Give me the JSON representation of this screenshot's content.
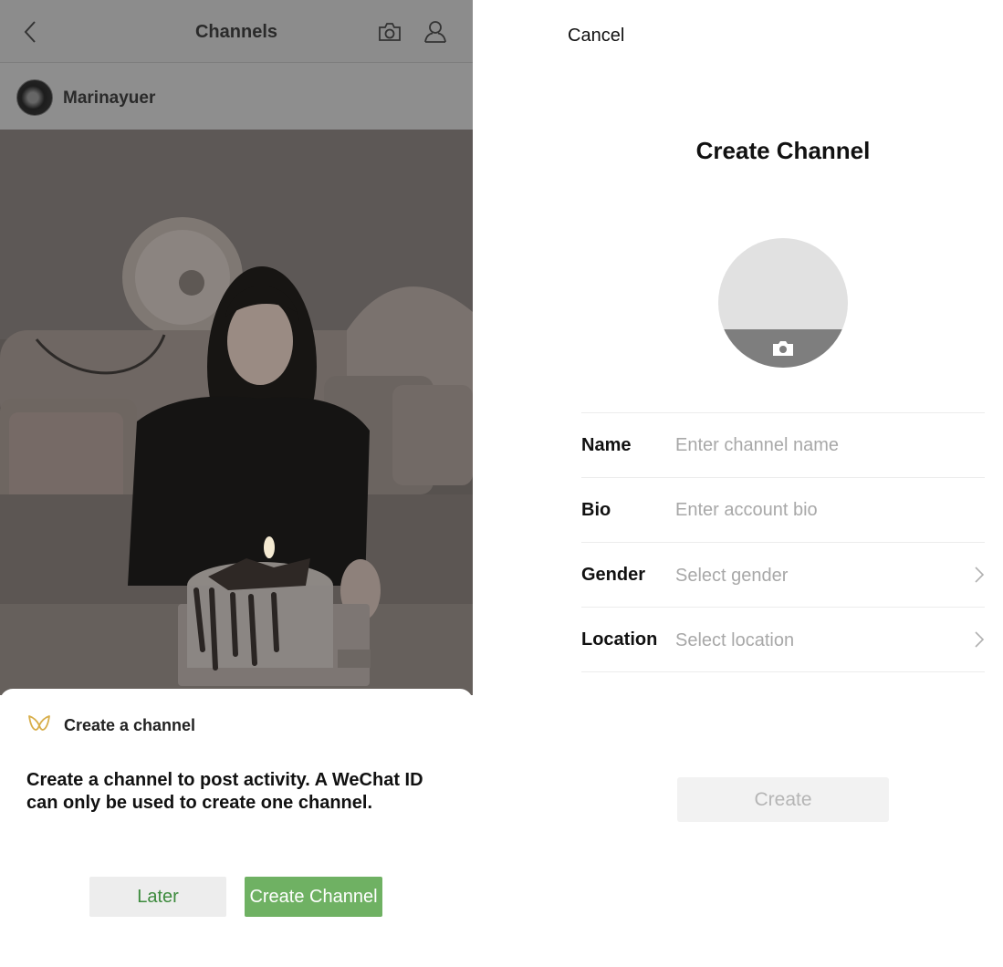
{
  "channels_screen": {
    "title": "Channels",
    "username": "Marinayuer",
    "sheet": {
      "heading": "Create a channel",
      "body": "Create a channel to post activity. A WeChat ID can only be used to create one channel.",
      "later_label": "Later",
      "create_label": "Create Channel"
    },
    "icons": {
      "back": "chevron-left-icon",
      "camera": "camera-icon",
      "profile": "person-icon",
      "channels_logo": "channels-logo-icon"
    },
    "colors": {
      "accent_green": "#6fb163",
      "logo_gold": "#d8ae4a"
    }
  },
  "create_form": {
    "cancel_label": "Cancel",
    "title": "Create Channel",
    "fields": [
      {
        "label": "Name",
        "placeholder": "Enter channel name"
      },
      {
        "label": "Bio",
        "placeholder": "Enter account bio"
      },
      {
        "label": "Gender",
        "placeholder": "Select gender"
      },
      {
        "label": "Location",
        "placeholder": "Select location"
      }
    ],
    "create_label": "Create"
  }
}
